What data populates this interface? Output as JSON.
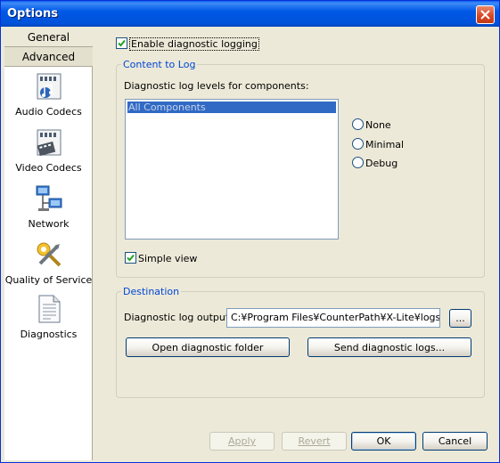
{
  "window": {
    "title": "Options"
  },
  "sidebar": {
    "tabs": [
      {
        "label": "General"
      },
      {
        "label": "Advanced"
      }
    ],
    "items": [
      {
        "label": "Audio Codecs",
        "icon": "audio-codecs-icon"
      },
      {
        "label": "Video Codecs",
        "icon": "video-codecs-icon"
      },
      {
        "label": "Network",
        "icon": "network-icon"
      },
      {
        "label": "Quality of Service",
        "icon": "qos-icon"
      },
      {
        "label": "Diagnostics",
        "icon": "diagnostics-icon"
      }
    ]
  },
  "main": {
    "enable_logging": {
      "label": "Enable diagnostic logging",
      "checked": true
    },
    "content_to_log": {
      "title": "Content to Log",
      "levels_label": "Diagnostic log levels for components:",
      "components": [
        "All Components"
      ],
      "levels": [
        {
          "label": "None"
        },
        {
          "label": "Minimal"
        },
        {
          "label": "Debug"
        }
      ],
      "simple_view": {
        "label": "Simple view",
        "checked": true
      }
    },
    "destination": {
      "title": "Destination",
      "output_label": "Diagnostic log output",
      "output_value": "C:¥Program Files¥CounterPath¥X-Lite¥logs",
      "browse_label": "...",
      "open_folder_label": "Open diagnostic folder",
      "send_logs_label": "Send diagnostic logs..."
    }
  },
  "footer": {
    "apply": "Apply",
    "revert": "Revert",
    "ok": "OK",
    "cancel": "Cancel"
  },
  "colors": {
    "titlebar": "#0054E3",
    "group_title": "#0046D5",
    "selection": "#316AC5"
  }
}
